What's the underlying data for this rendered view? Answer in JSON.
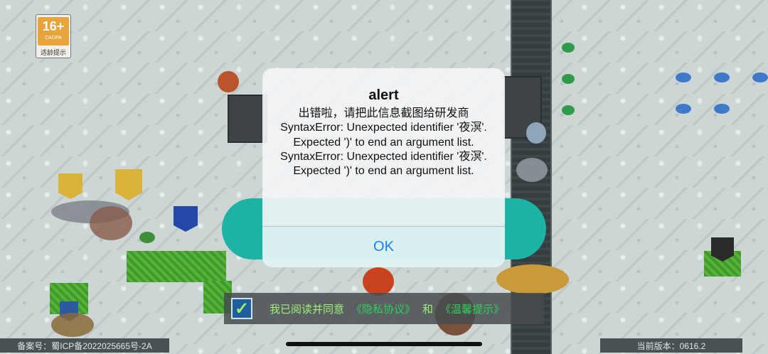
{
  "age_rating": {
    "rating": "16+",
    "org": "CADPA",
    "label": "适龄提示"
  },
  "alert": {
    "title": "alert",
    "message": "出错啦，请把此信息截图给研发商\nSyntaxError: Unexpected identifier '夜溟'. Expected ')' to end an argument list.\nSyntaxError: Unexpected identifier '夜溟'. Expected ')' to end an argument list.",
    "ok_label": "OK"
  },
  "agreement": {
    "checked_glyph": "✓",
    "text": "我已阅读并同意",
    "privacy_link": "《隐私协议》",
    "and": "和",
    "tips_link": "《温馨提示》"
  },
  "footer": {
    "icp": "备案号：蜀ICP备2022025665号-2A",
    "version": "当前版本：0616.2"
  },
  "colors": {
    "teal_button": "#1ab3a4",
    "ok_text": "#1a7ff0",
    "link_green": "#2ccf5b"
  }
}
